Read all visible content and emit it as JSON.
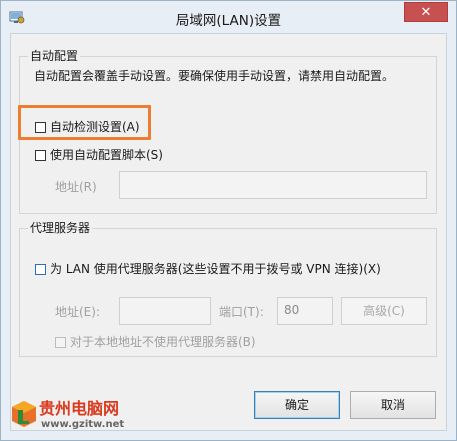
{
  "window": {
    "title": "局域网(LAN)设置",
    "close_glyph": "✕"
  },
  "auto_config": {
    "legend": "自动配置",
    "description": "自动配置会覆盖手动设置。要确保使用手动设置，请禁用自动配置。",
    "auto_detect_label": "自动检测设置(A)",
    "auto_detect_checked": false,
    "use_script_label": "使用自动配置脚本(S)",
    "use_script_checked": false,
    "address_label": "地址(R)",
    "address_value": ""
  },
  "proxy": {
    "legend": "代理服务器",
    "use_proxy_label": "为 LAN 使用代理服务器(这些设置不用于拨号或 VPN 连接)(X)",
    "use_proxy_checked": false,
    "address_label": "地址(E):",
    "address_value": "",
    "port_label": "端口(T):",
    "port_value": "80",
    "advanced_label": "高级(C)",
    "bypass_local_label": "对于本地地址不使用代理服务器(B)",
    "bypass_local_checked": false
  },
  "buttons": {
    "ok_label": "确定",
    "cancel_label": "取消"
  },
  "watermark": {
    "title": "贵州电脑网",
    "url": "www.gzitw.net"
  },
  "colors": {
    "highlight": "#ed7d31",
    "close": "#c75050",
    "checkbox_blue": "#2c6fb7"
  }
}
